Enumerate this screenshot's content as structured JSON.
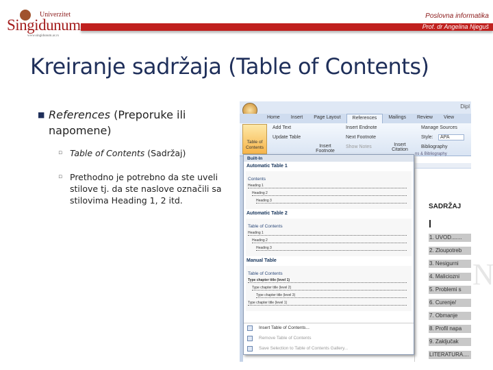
{
  "header": {
    "logo_top": "Univerzitet",
    "logo_main": "Singidunum",
    "logo_url": "www.singidunum.ac.rs",
    "course": "Poslovna informatika",
    "professor": "Prof. dr Angelina Njeguš"
  },
  "slide": {
    "title": "Kreiranje sadržaja (Table of Contents)",
    "bullets": [
      {
        "italic": "References",
        "text": " (Preporuke ili napomene)"
      }
    ],
    "sub_bullets": [
      {
        "italic": "Table of Contents",
        "text": " (Sadržaj)"
      },
      {
        "text": "Prethodno je potrebno da ste uveli stilove tj. da ste naslove označili sa stilovima Heading 1, 2 itd."
      }
    ]
  },
  "word": {
    "doc_title": "Dipl",
    "tabs": [
      "Home",
      "Insert",
      "Page Layout",
      "References",
      "Mailings",
      "Review",
      "View"
    ],
    "active_tab": "References",
    "ribbon": {
      "toc": "Table of Contents",
      "add_text": "Add Text",
      "update_table": "Update Table",
      "insert_footnote": "Insert Footnote",
      "insert_endnote": "Insert Endnote",
      "next_footnote": "Next Footnote",
      "show_notes": "Show Notes",
      "insert_citation": "Insert Citation",
      "manage_sources": "Manage Sources",
      "style_label": "Style:",
      "style_value": "APA",
      "bibliography": "Bibliography",
      "group_citations": "ns & Bibliography"
    },
    "dropdown": {
      "header": "Built-In",
      "sections": [
        {
          "title": "Automatic Table 1",
          "preview_heading": "Contents",
          "lines": [
            "Heading 1",
            "Heading 2",
            "Heading 3"
          ]
        },
        {
          "title": "Automatic Table 2",
          "preview_heading": "Table of Contents",
          "lines": [
            "Heading 1",
            "Heading 2",
            "Heading 3"
          ]
        },
        {
          "title": "Manual Table",
          "preview_heading": "Table of Contents",
          "lines": [
            "Type chapter title (level 1)",
            "Type chapter title (level 2)",
            "Type chapter title (level 3)",
            "Type chapter title (level 1)"
          ]
        }
      ],
      "actions": [
        {
          "label": "Insert Table of Contents...",
          "enabled": true
        },
        {
          "label": "Remove Table of Contents",
          "enabled": false
        },
        {
          "label": "Save Selection to Table of Contents Gallery...",
          "enabled": true
        }
      ]
    },
    "document": {
      "heading": "SADRŽAJ",
      "toc_items": [
        "1.  UVOD.......",
        "2.  Zloupotreb",
        "3.  Nesigurni",
        "4.  Maliciozni",
        "5.  Problemi s",
        "6.  Curenje/",
        "7.  Obmanje",
        "8.  Profil napa",
        "9.  Zaključak",
        "LITERATURA...."
      ]
    }
  },
  "watermark": "NI"
}
